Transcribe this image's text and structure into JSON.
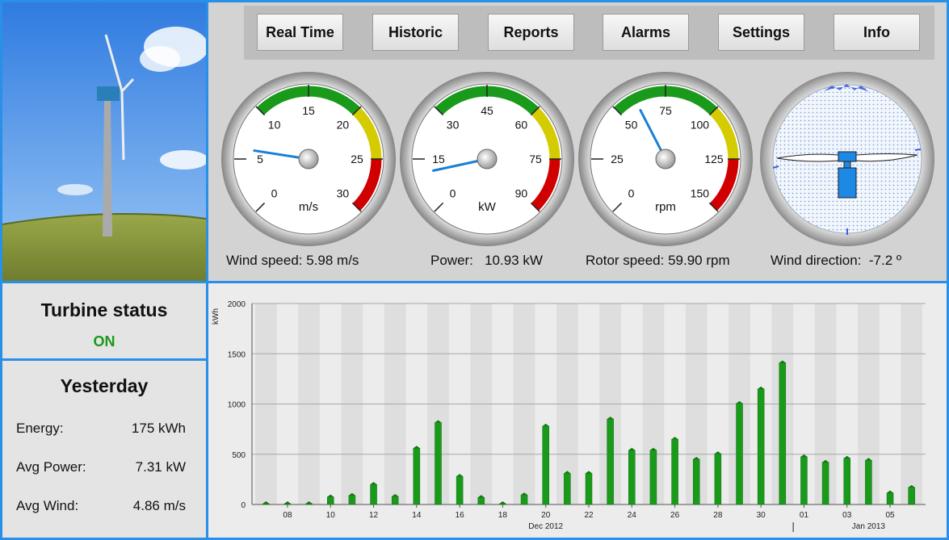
{
  "nav": {
    "buttons": [
      "Real Time",
      "Historic",
      "Reports",
      "Alarms",
      "Settings",
      "Info"
    ]
  },
  "gauges": [
    {
      "id": "wind-speed",
      "unit": "m/s",
      "ticks": [
        "0",
        "5",
        "10",
        "15",
        "20",
        "25",
        "30"
      ],
      "min": 0,
      "max": 30,
      "value": 5.98,
      "readout_label": "Wind speed:",
      "readout_value": "5.98 m/s"
    },
    {
      "id": "power",
      "unit": "kW",
      "ticks": [
        "0",
        "15",
        "30",
        "45",
        "60",
        "75",
        "90"
      ],
      "min": 0,
      "max": 90,
      "value": 10.93,
      "readout_label": "Power:",
      "readout_value": "10.93 kW"
    },
    {
      "id": "rotor-speed",
      "unit": "rpm",
      "ticks": [
        "0",
        "25",
        "50",
        "75",
        "100",
        "125",
        "150"
      ],
      "min": 0,
      "max": 150,
      "value": 59.9,
      "readout_label": "Rotor speed:",
      "readout_value": "59.90 rpm"
    }
  ],
  "wind_direction": {
    "readout_label": "Wind direction:",
    "readout_value": "-7.2 º",
    "value_deg": -7.2
  },
  "colors": {
    "accent_border": "#2a8fe6",
    "bar": "#1a9a1a",
    "needle": "#1a7fd4",
    "status_on": "#1a9a1a",
    "zone_green": "#1a9a1a",
    "zone_yellow": "#d4cc00",
    "zone_red": "#d10000"
  },
  "turbine_status": {
    "title": "Turbine status",
    "value": "ON"
  },
  "yesterday": {
    "title": "Yesterday",
    "rows": [
      {
        "label": "Energy:",
        "value": "175 kWh"
      },
      {
        "label": "Avg Power:",
        "value": "7.31 kW"
      },
      {
        "label": "Avg Wind:",
        "value": "4.86 m/s"
      }
    ]
  },
  "chart_data": {
    "type": "bar",
    "ylabel": "kWh",
    "ylim": [
      0,
      2000
    ],
    "yticks": [
      "0",
      "500",
      "1000",
      "1500",
      "2000"
    ],
    "x_tick_labels": [
      "08",
      "10",
      "12",
      "14",
      "16",
      "18",
      "20",
      "22",
      "24",
      "26",
      "28",
      "30",
      "01",
      "03",
      "05"
    ],
    "x_month_labels": [
      "Dec 2012",
      "Jan 2013"
    ],
    "grid": true,
    "dates": [
      "2012-12-07",
      "2012-12-08",
      "2012-12-09",
      "2012-12-10",
      "2012-12-11",
      "2012-12-12",
      "2012-12-13",
      "2012-12-14",
      "2012-12-15",
      "2012-12-16",
      "2012-12-17",
      "2012-12-18",
      "2012-12-19",
      "2012-12-20",
      "2012-12-21",
      "2012-12-22",
      "2012-12-23",
      "2012-12-24",
      "2012-12-25",
      "2012-12-26",
      "2012-12-27",
      "2012-12-28",
      "2012-12-29",
      "2012-12-30",
      "2012-12-31",
      "2013-01-01",
      "2013-01-02",
      "2013-01-03",
      "2013-01-04",
      "2013-01-05",
      "2013-01-06"
    ],
    "values": [
      5,
      5,
      5,
      75,
      90,
      200,
      80,
      560,
      815,
      280,
      70,
      5,
      95,
      780,
      310,
      310,
      850,
      540,
      540,
      650,
      450,
      505,
      1005,
      1150,
      1410,
      475,
      420,
      460,
      440,
      115,
      170
    ]
  }
}
